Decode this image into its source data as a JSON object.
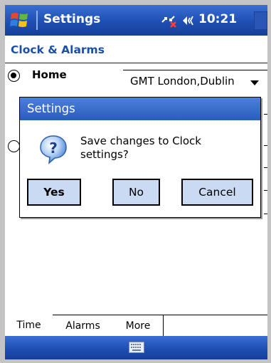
{
  "titlebar": {
    "app_title": "Settings",
    "time": "10:21",
    "icons": [
      "windows-start-icon",
      "connectivity-icon",
      "volume-icon"
    ]
  },
  "page": {
    "title": "Clock & Alarms",
    "home_label": "Home",
    "home_selected": true,
    "timezone": "GMT London,Dublin"
  },
  "dialog": {
    "title": "Settings",
    "message_line1": "Save changes to Clock",
    "message_line2": "settings?",
    "icon": "question-icon",
    "buttons": {
      "yes": "Yes",
      "no": "No",
      "cancel": "Cancel"
    }
  },
  "tabs": [
    {
      "label": "Time",
      "active": true
    },
    {
      "label": "Alarms",
      "active": false
    },
    {
      "label": "More",
      "active": false
    }
  ],
  "softkey": {
    "icon": "keyboard-icon"
  },
  "colors": {
    "titlebar": "#1f4fb3",
    "page_title": "#1a4fa8",
    "button_fill": "#c9daf2",
    "dialog_title": "#2a5cbf"
  }
}
